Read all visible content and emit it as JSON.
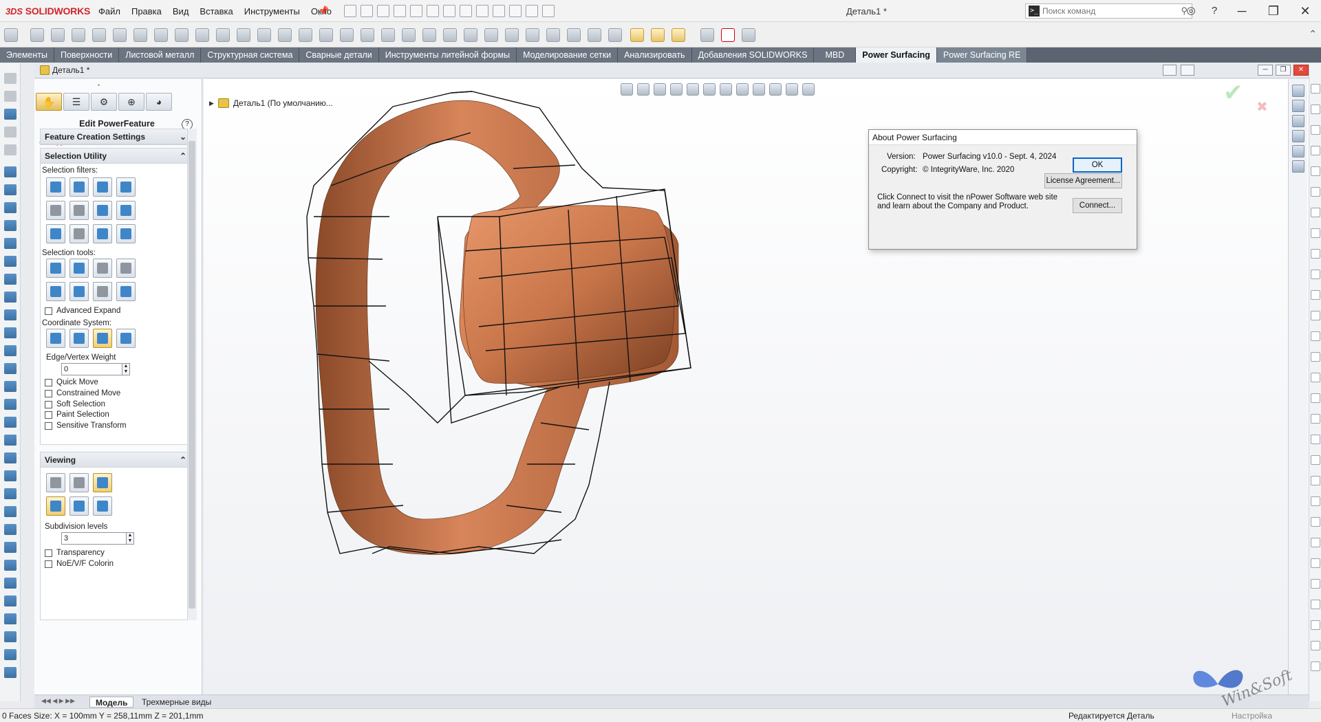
{
  "app": {
    "name": "SOLIDWORKS",
    "logo_mark": "3DS",
    "menu": [
      "Файл",
      "Правка",
      "Вид",
      "Вставка",
      "Инструменты",
      "Окно"
    ],
    "doc_title": "Деталь1 *",
    "search_placeholder": "Поиск команд"
  },
  "tabs": [
    {
      "label": "Элементы"
    },
    {
      "label": "Поверхности"
    },
    {
      "label": "Листовой металл"
    },
    {
      "label": "Структурная система"
    },
    {
      "label": "Сварные детали"
    },
    {
      "label": "Инструменты литейной формы"
    },
    {
      "label": "Моделирование сетки"
    },
    {
      "label": "Анализировать"
    },
    {
      "label": "Добавления SOLIDWORKS"
    },
    {
      "label": "MBD"
    },
    {
      "label": "Power Surfacing"
    },
    {
      "label": "Power Surfacing RE"
    }
  ],
  "active_tab": "Power Surfacing",
  "document": {
    "name": "Деталь1 *",
    "tree_root": "Деталь1 (По умолчанию..."
  },
  "property_manager": {
    "title": "Edit PowerFeature",
    "help": "?",
    "group_feature_settings": "Feature Creation Settings",
    "group_selection": "Selection Utility",
    "selection_filters": "Selection filters:",
    "selection_tools": "Selection tools:",
    "advanced_expand": "Advanced Expand",
    "coordinate_system": "Coordinate System:",
    "edge_vertex_weight": "Edge/Vertex Weight",
    "weight_value": "0",
    "checkboxes": [
      "Quick Move",
      "Constrained Move",
      "Soft Selection",
      "Paint Selection",
      "Sensitive Transform"
    ],
    "group_viewing": "Viewing",
    "subdivision_label": "Subdivision levels",
    "subdivision_value": "3",
    "view_checkboxes": [
      "Transparency",
      "NoE/V/F Colorin"
    ]
  },
  "model_tabs": [
    "Модель",
    "Трехмерные виды"
  ],
  "about": {
    "title": "About Power Surfacing",
    "version_label": "Version:",
    "version_value": "Power Surfacing v10.0 - Sept. 4, 2024",
    "copyright_label": "Copyright:",
    "copyright_value": "© IntegrityWare, Inc. 2020",
    "message_line1": "Click Connect to visit the nPower Software web site",
    "message_line2": "and learn about the Company and Product.",
    "ok": "OK",
    "license": "License Agreement...",
    "connect": "Connect..."
  },
  "status": {
    "left": "0 Faces Size: X = 100mm Y = 258,11mm Z = 201,1mm",
    "mid": "Редактируется Деталь",
    "right": "Настройка"
  },
  "watermark": "Win&Soft",
  "colors": {
    "brand_red": "#d2232a",
    "model_copper": "#c8754a",
    "tab_bar": "#5b6470",
    "accept_green": "#23a023"
  }
}
